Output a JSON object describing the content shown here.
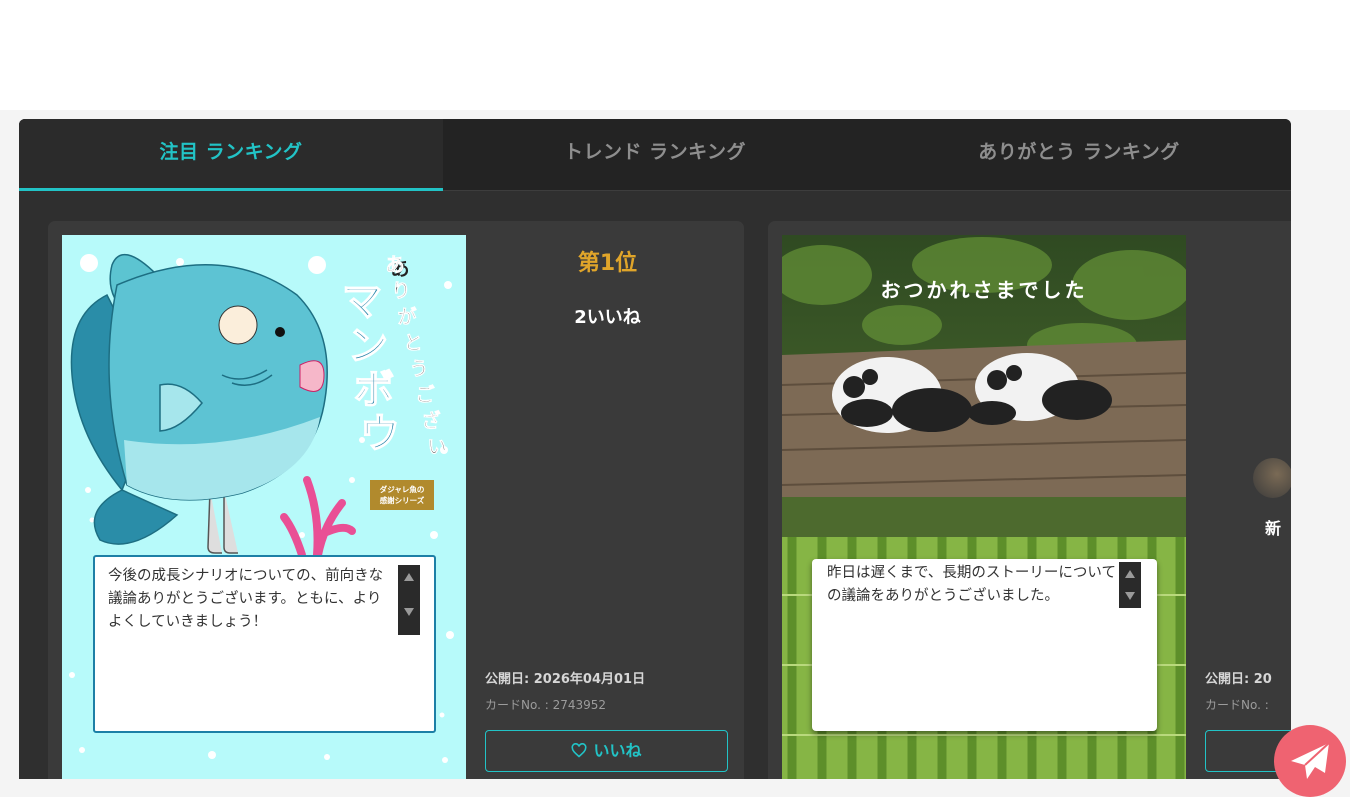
{
  "tabs": [
    {
      "label": "注目 ランキング",
      "active": true
    },
    {
      "label": "トレンド ランキング",
      "active": false
    },
    {
      "label": "ありがとう ランキング",
      "active": false
    }
  ],
  "cards": [
    {
      "image_text": {
        "title_line1": "ありがとうござい",
        "title_line2": "マンボウ",
        "badge_line1": "ダジャレ魚の",
        "badge_line2": "感謝シリーズ"
      },
      "message": "今後の成長シナリオについての、前向きな議論ありがとうございます。ともに、よりよくしていきましょう！",
      "rank": "第1位",
      "likes": "2いいね",
      "published": "公開日:  2026年04月01日",
      "card_no": "カードNo. : 2743952",
      "like_button": "いいね"
    },
    {
      "image_text": {
        "caption": "おつかれさまでした"
      },
      "message": "昨日は遅くまで、長期のストーリーについての議論をありがとうございました。",
      "published": "公開日:  20",
      "card_no": "カードNo. :",
      "author_partial": "新"
    }
  ],
  "colors": {
    "accent": "#22c3c6",
    "rank_gold": "#e0a52a",
    "panel": "#2f2f2f",
    "fab": "#ef6371"
  },
  "icons": [
    "heart-icon",
    "scroll-up-icon",
    "scroll-down-icon",
    "paper-plane-icon"
  ]
}
